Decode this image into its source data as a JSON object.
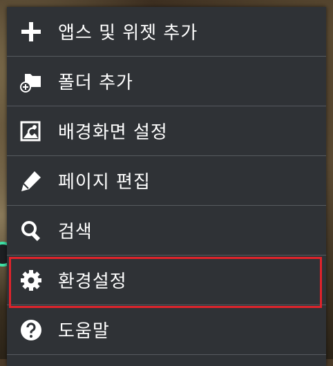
{
  "menu": {
    "items": [
      {
        "label": "앱스 및 위젯 추가",
        "icon": "plus-icon"
      },
      {
        "label": "폴더 추가",
        "icon": "folder-add-icon"
      },
      {
        "label": "배경화면 설정",
        "icon": "wallpaper-icon"
      },
      {
        "label": "페이지 편집",
        "icon": "pencil-icon"
      },
      {
        "label": "검색",
        "icon": "search-icon"
      },
      {
        "label": "환경설정",
        "icon": "gear-icon"
      },
      {
        "label": "도움말",
        "icon": "help-icon"
      }
    ],
    "highlighted_item": "환경설정"
  },
  "colors": {
    "menu_background": "#2f3236",
    "divider": "#575b60",
    "text": "#ffffff",
    "highlight_border": "#e0232b",
    "edge_handle": "#3fe3a8"
  }
}
